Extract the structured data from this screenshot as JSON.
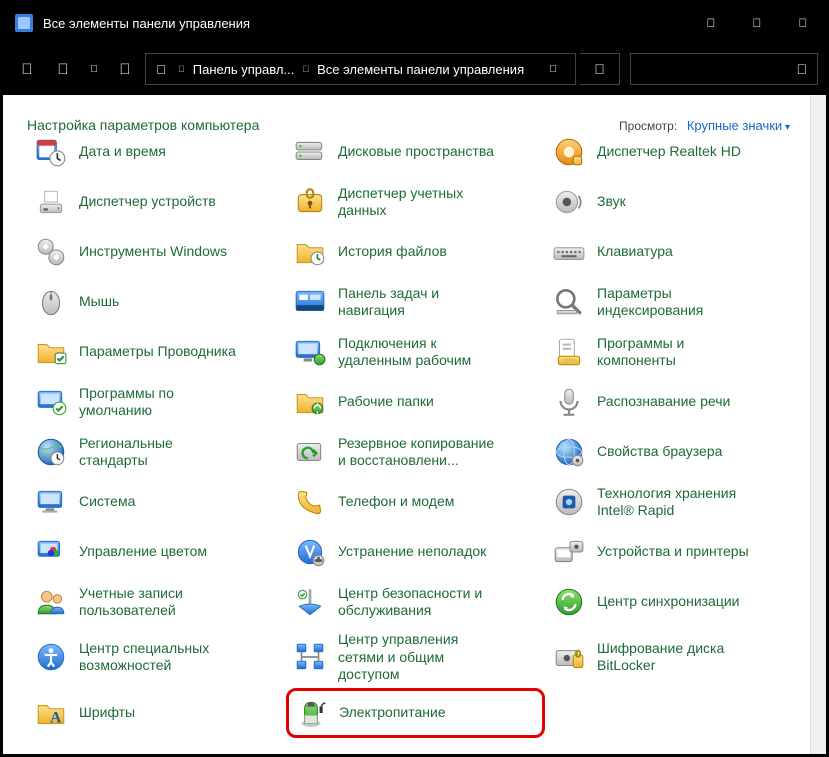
{
  "window": {
    "title": "Все элементы панели управления"
  },
  "breadcrumb": {
    "seg1": "Панель управл...",
    "seg2": "Все элементы панели управления"
  },
  "heading": "Настройка параметров компьютера",
  "view": {
    "label": "Просмотр:",
    "value": "Крупные значки"
  },
  "items": [
    {
      "label": "Дата и время",
      "icon": "datetime"
    },
    {
      "label": "Дисковые пространства",
      "icon": "storage"
    },
    {
      "label": "Диспетчер Realtek HD",
      "icon": "realtek"
    },
    {
      "label": "Диспетчер устройств",
      "icon": "devmgr"
    },
    {
      "label": "Диспетчер учетных данных",
      "icon": "cred"
    },
    {
      "label": "Звук",
      "icon": "sound"
    },
    {
      "label": "Инструменты Windows",
      "icon": "tools"
    },
    {
      "label": "История файлов",
      "icon": "filehist"
    },
    {
      "label": "Клавиатура",
      "icon": "keyboard"
    },
    {
      "label": "Мышь",
      "icon": "mouse"
    },
    {
      "label": "Панель задач и навигация",
      "icon": "taskbar"
    },
    {
      "label": "Параметры индексирования",
      "icon": "indexing"
    },
    {
      "label": "Параметры Проводника",
      "icon": "explorer"
    },
    {
      "label": "Подключения к удаленным рабочим",
      "icon": "remoteapp"
    },
    {
      "label": "Программы и компоненты",
      "icon": "programs"
    },
    {
      "label": "Программы по умолчанию",
      "icon": "defprog"
    },
    {
      "label": "Рабочие папки",
      "icon": "workfolders"
    },
    {
      "label": "Распознавание речи",
      "icon": "speech"
    },
    {
      "label": "Региональные стандарты",
      "icon": "region"
    },
    {
      "label": "Резервное копирование и восстановлени...",
      "icon": "backup"
    },
    {
      "label": "Свойства браузера",
      "icon": "inetopt"
    },
    {
      "label": "Система",
      "icon": "system"
    },
    {
      "label": "Телефон и модем",
      "icon": "phone"
    },
    {
      "label": "Технология хранения Intel® Rapid",
      "icon": "intel"
    },
    {
      "label": "Управление цветом",
      "icon": "color"
    },
    {
      "label": "Устранение неполадок",
      "icon": "troubleshoot"
    },
    {
      "label": "Устройства и принтеры",
      "icon": "devices"
    },
    {
      "label": "Учетные записи пользователей",
      "icon": "users"
    },
    {
      "label": "Центр безопасности и обслуживания",
      "icon": "actioncenter"
    },
    {
      "label": "Центр синхронизации",
      "icon": "sync"
    },
    {
      "label": "Центр специальных возможностей",
      "icon": "ease"
    },
    {
      "label": "Центр управления сетями и общим доступом",
      "icon": "network"
    },
    {
      "label": "Шифрование диска BitLocker",
      "icon": "bitlocker"
    },
    {
      "label": "Шрифты",
      "icon": "fonts"
    },
    {
      "label": "Электропитание",
      "icon": "power",
      "highlight": true
    }
  ]
}
